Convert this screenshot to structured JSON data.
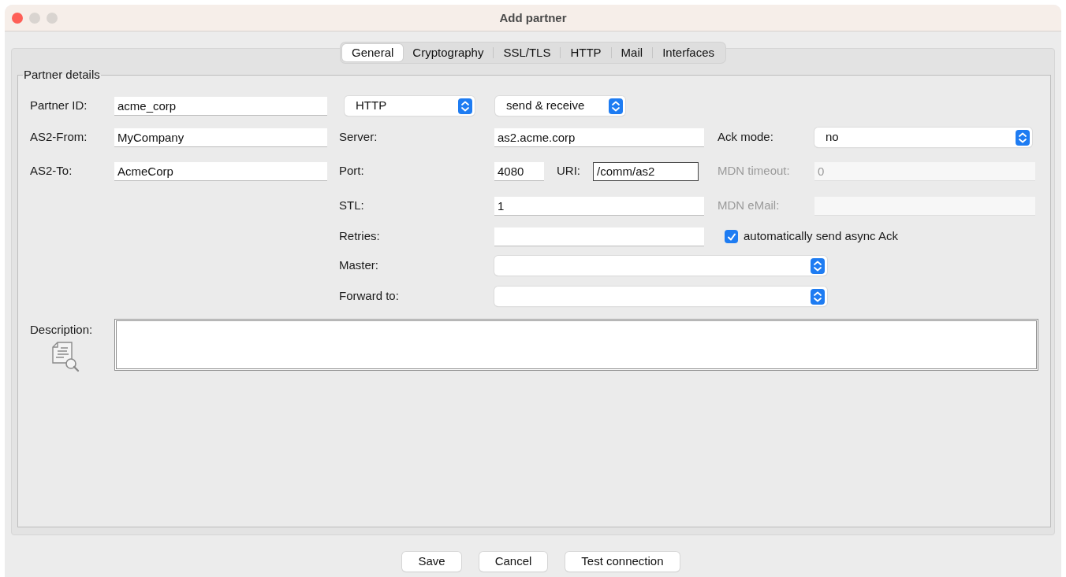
{
  "window": {
    "title": "Add partner"
  },
  "tabs": [
    {
      "label": "General",
      "selected": true
    },
    {
      "label": "Cryptography",
      "selected": false
    },
    {
      "label": "SSL/TLS",
      "selected": false
    },
    {
      "label": "HTTP",
      "selected": false
    },
    {
      "label": "Mail",
      "selected": false
    },
    {
      "label": "Interfaces",
      "selected": false
    }
  ],
  "partner_details": {
    "legend": "Partner details",
    "partner_id": {
      "label": "Partner ID:",
      "value": "acme_corp"
    },
    "protocol": {
      "value": "HTTP"
    },
    "direction": {
      "value": "send & receive"
    },
    "as2_from": {
      "label": "AS2-From:",
      "value": "MyCompany"
    },
    "server": {
      "label": "Server:",
      "value": "as2.acme.corp"
    },
    "ack_mode": {
      "label": "Ack mode:",
      "value": "no"
    },
    "as2_to": {
      "label": "AS2-To:",
      "value": "AcmeCorp"
    },
    "port": {
      "label": "Port:",
      "value": "4080"
    },
    "uri": {
      "label": "URI:",
      "value": "/comm/as2",
      "focused": true
    },
    "mdn_timeout": {
      "label": "MDN timeout:",
      "value": "0",
      "disabled": true
    },
    "stl": {
      "label": "STL:",
      "value": "1"
    },
    "mdn_email": {
      "label": "MDN eMail:",
      "disabled": true
    },
    "retries": {
      "label": "Retries:"
    },
    "auto_async_ack": {
      "label": "automatically send async Ack",
      "checked": true
    },
    "master": {
      "label": "Master:"
    },
    "forward_to": {
      "label": "Forward to:"
    },
    "description": {
      "label": "Description:"
    }
  },
  "buttons": [
    "Save",
    "Cancel",
    "Test connection"
  ]
}
